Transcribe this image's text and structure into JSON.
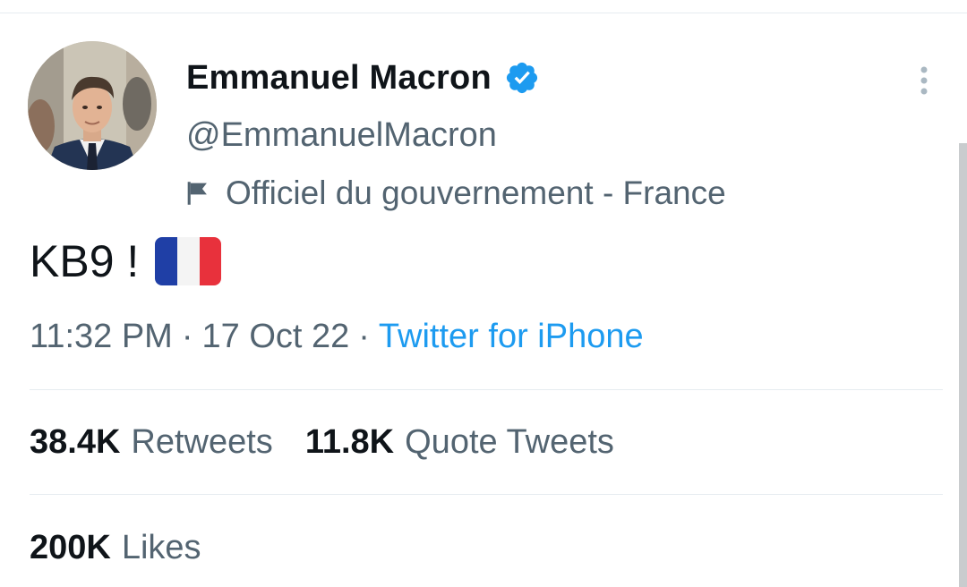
{
  "author": {
    "display_name": "Emmanuel Macron",
    "handle": "@EmmanuelMacron",
    "label": "Officiel du gouvernement - France",
    "verified_icon": "verified-badge-icon",
    "label_icon": "flag-icon"
  },
  "tweet": {
    "text": "KB9 !",
    "emoji": "flag-france",
    "time": "11:32 PM",
    "date": "17 Oct 22",
    "separator": "·",
    "source": "Twitter for iPhone"
  },
  "stats": {
    "retweets_count": "38.4K",
    "retweets_label": "Retweets",
    "quotes_count": "11.8K",
    "quotes_label": "Quote Tweets",
    "likes_count": "200K",
    "likes_label": "Likes"
  },
  "colors": {
    "text_primary": "#0f1419",
    "text_secondary": "#536471",
    "accent": "#1d9bf0",
    "divider": "#e6ecf0"
  }
}
